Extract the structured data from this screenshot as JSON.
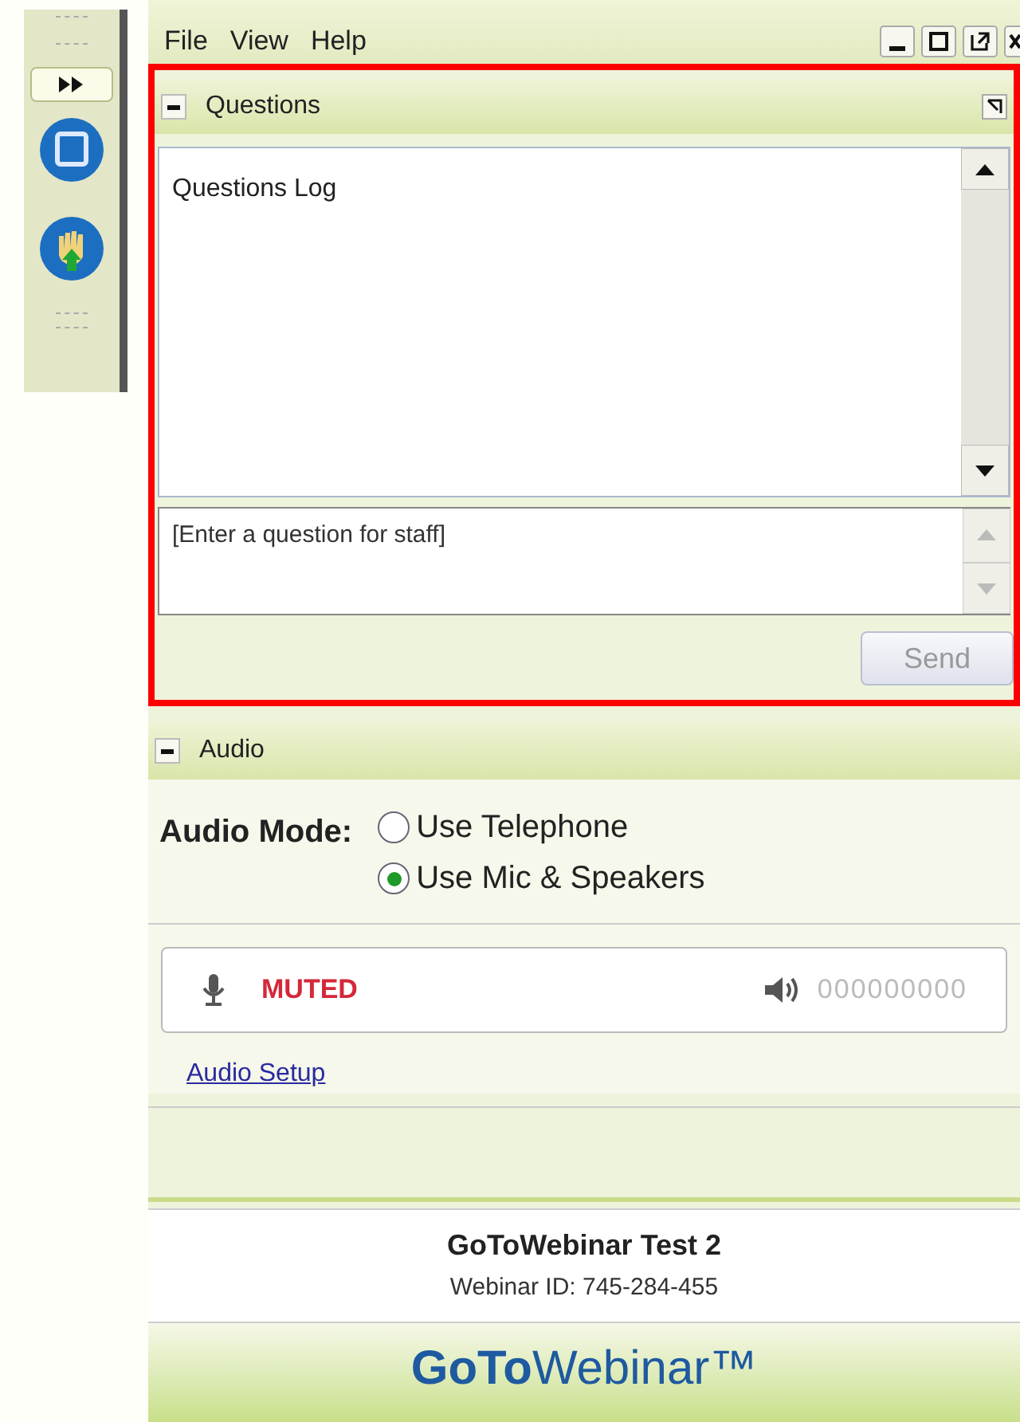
{
  "menu": [
    "File",
    "View",
    "Help"
  ],
  "questions": {
    "title": "Questions",
    "expanded": true,
    "log_title": "Questions Log",
    "input": {
      "placeholder": "[Enter a question for staff]"
    },
    "send": {
      "label": "Send",
      "disabled": true
    }
  },
  "audio": {
    "title": "Audio",
    "expanded": true,
    "mode_label": "Audio Mode:",
    "options": [
      {
        "label": "Use Telephone",
        "selected": false
      },
      {
        "label": "Use Mic & Speakers",
        "selected": true
      }
    ],
    "status": "MUTED",
    "muted": true,
    "speaker_level": "000000000",
    "setup_link": "Audio Setup"
  },
  "footer": {
    "title": "GoToWebinar Test 2",
    "webinar_id": "Webinar ID: 745-284-455",
    "logo": "**GoTo**Webinar™"
  }
}
